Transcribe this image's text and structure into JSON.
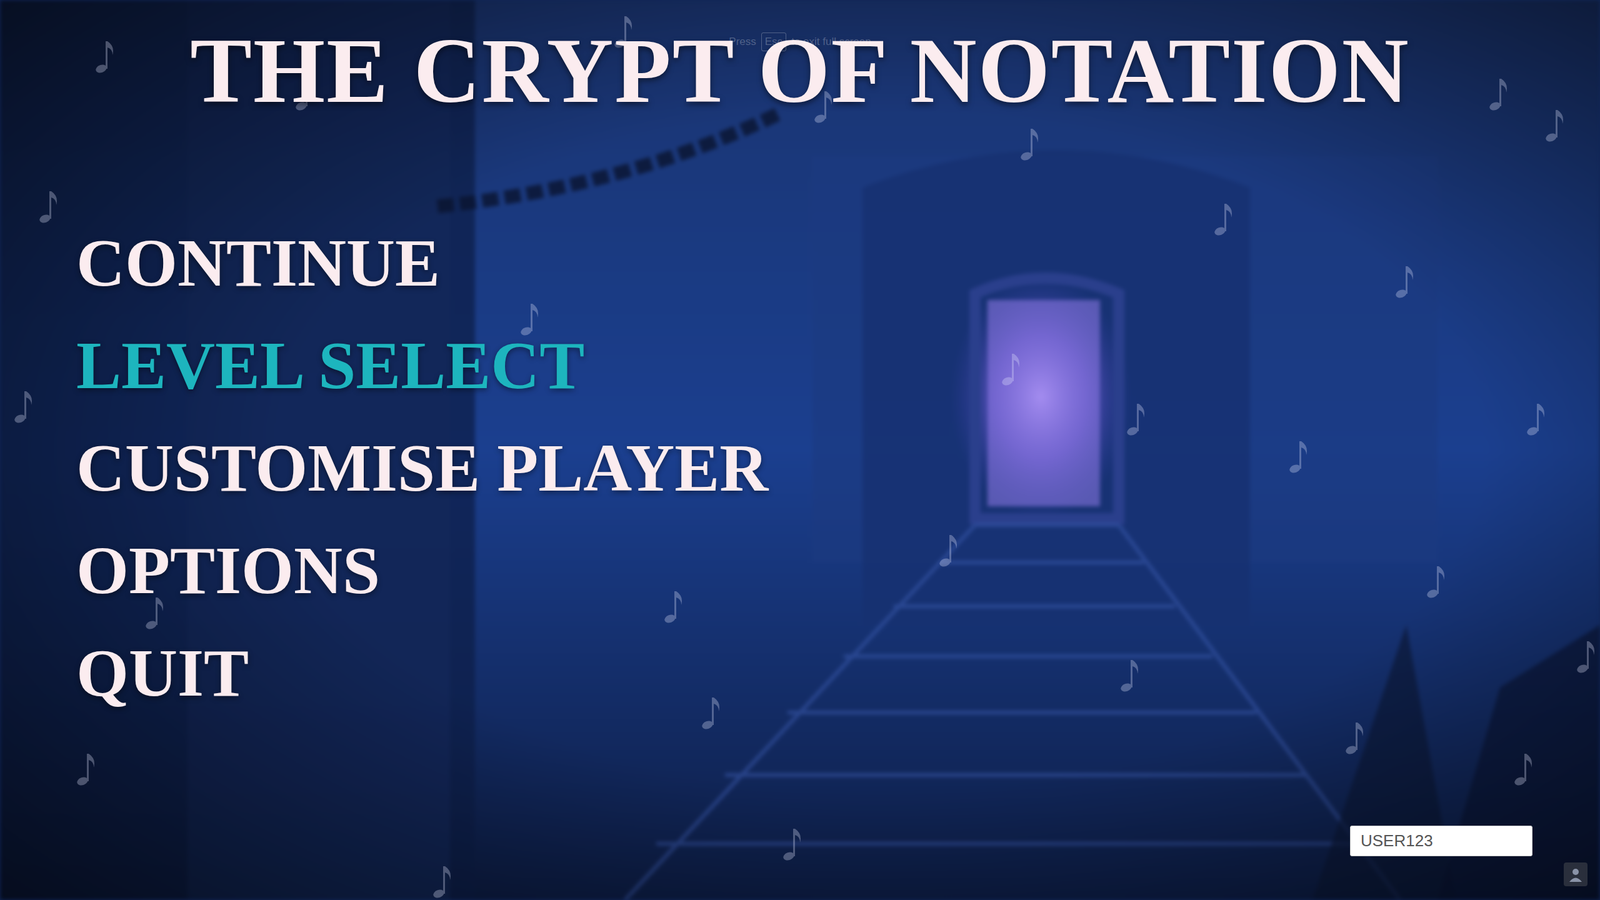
{
  "fullscreen_hint": {
    "before": "Press",
    "key": "Esc",
    "after": "to exit full screen"
  },
  "title": "THE CRYPT OF NOTATION",
  "menu": [
    {
      "label": "CONTINUE",
      "selected": false
    },
    {
      "label": "LEVEL SELECT",
      "selected": true
    },
    {
      "label": "CUSTOMISE PLAYER",
      "selected": false
    },
    {
      "label": "OPTIONS",
      "selected": false
    },
    {
      "label": "QUIT",
      "selected": false
    }
  ],
  "username": {
    "value": "USER123"
  }
}
